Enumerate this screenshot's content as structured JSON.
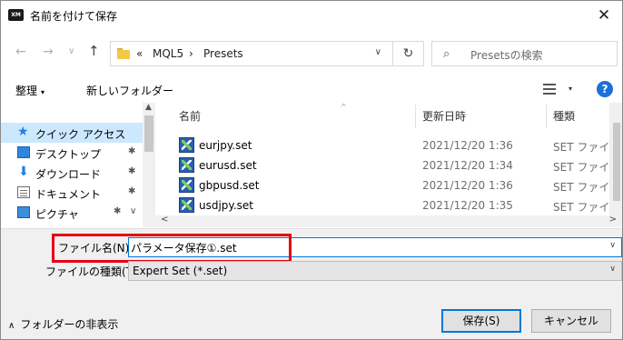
{
  "window": {
    "app_logo_text": "XM",
    "title": "名前を付けて保存",
    "close_glyph": "✕"
  },
  "address": {
    "back_glyph": "←",
    "forward_glyph": "→",
    "history_glyph": "∨",
    "up_glyph": "↑",
    "overflow": "«",
    "crumb1": "MQL5",
    "separator": "›",
    "crumb2": "Presets",
    "dropdown_glyph": "∨",
    "refresh_glyph": "↻",
    "search_glyph": "⌕",
    "search_placeholder": "Presetsの検索"
  },
  "toolbar": {
    "organize": "整理",
    "organize_caret": "▾",
    "new_folder": "新しいフォルダー",
    "view_caret": "▾",
    "help": "?"
  },
  "nav": {
    "items": [
      {
        "label": "クイック アクセス",
        "icon": "star-icon",
        "selected": true
      },
      {
        "label": "デスクトップ",
        "icon": "desktop-icon",
        "pin": "✱"
      },
      {
        "label": "ダウンロード",
        "icon": "download-icon",
        "pin": "✱"
      },
      {
        "label": "ドキュメント",
        "icon": "document-icon",
        "pin": "✱"
      },
      {
        "label": "ピクチャ",
        "icon": "pictures-icon",
        "pin": "✱"
      }
    ],
    "scroll_up": "▲",
    "expand_glyph": "∨"
  },
  "filelist": {
    "headers": {
      "name": "名前",
      "date": "更新日時",
      "type": "種類"
    },
    "sort_glyph": "^",
    "files": [
      {
        "name": "eurjpy.set",
        "date": "2021/12/20 1:36",
        "type": "SET ファイル"
      },
      {
        "name": "eurusd.set",
        "date": "2021/12/20 1:34",
        "type": "SET ファイル"
      },
      {
        "name": "gbpusd.set",
        "date": "2021/12/20 1:36",
        "type": "SET ファイル"
      },
      {
        "name": "usdjpy.set",
        "date": "2021/12/20 1:35",
        "type": "SET ファイル"
      }
    ],
    "hscroll_left": "<",
    "hscroll_right": ">"
  },
  "form": {
    "filename_label": "ファイル名(N):",
    "filename_value": "パラメータ保存①.set",
    "filetype_label": "ファイルの種類(T):",
    "filetype_value": "Expert Set (*.set)",
    "dropdown_glyph": "∨",
    "hide_folders": "フォルダーの非表示",
    "hide_folders_glyph": "∧",
    "save": "保存(S)",
    "cancel": "キャンセル"
  },
  "colors": {
    "highlight": "#e60012",
    "accent": "#0078d7",
    "selected_nav": "#cce8ff"
  }
}
